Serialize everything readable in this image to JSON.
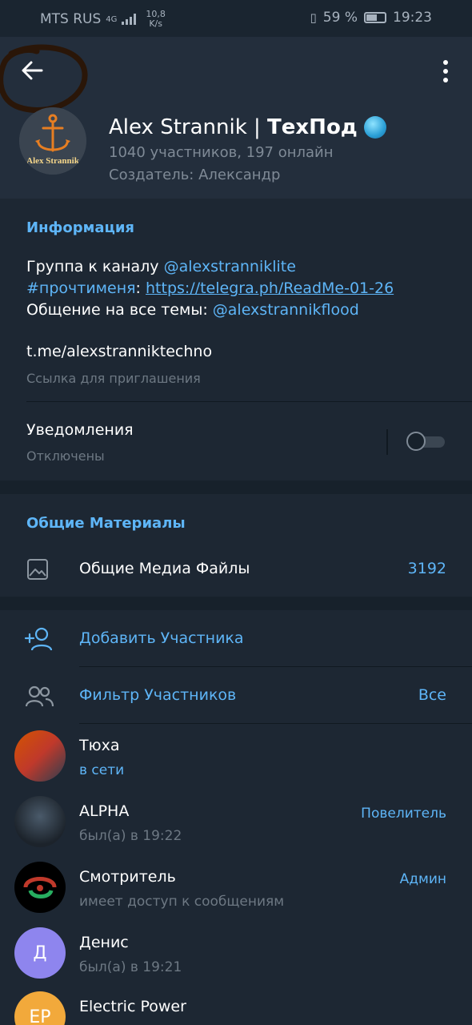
{
  "status_bar": {
    "carrier": "MTS RUS",
    "network": "4G",
    "speed_value": "10,8",
    "speed_unit": "K/s",
    "battery": "59 %",
    "time": "19:23"
  },
  "header": {
    "name": "Alex Strannik | ",
    "name_bold": "ТехПод",
    "members_online": "1040 участников, 197 онлайн",
    "creator": "Создатель: Александр",
    "logo_text": "Alex Strannik",
    "icons": [
      "arrow-left-icon",
      "more-vertical-icon",
      "globe-emoji-icon"
    ]
  },
  "info": {
    "section_title": "Информация",
    "line1_text": "Группа к каналу ",
    "line1_link": "@alexstranniklite",
    "line2_tag": "#прочтименя",
    "line2_sep": ": ",
    "line2_link": "https://telegra.ph/ReadMe-01-26",
    "line3_text": "Общение на все темы: ",
    "line3_link": "@alexstrannikflood",
    "invite_link": "t.me/alexstranniktechno",
    "invite_caption": "Ссылка для приглашения",
    "notifications_label": "Уведомления",
    "notifications_state": "Отключены",
    "notifications_enabled": false
  },
  "shared": {
    "section_title": "Общие Материалы",
    "media_label": "Общие Медиа Файлы",
    "media_count": "3192"
  },
  "members": {
    "add_label": "Добавить Участника",
    "filter_label": "Фильтр Участников",
    "filter_value": "Все",
    "list": [
      {
        "name": "Тюха",
        "status": "в сети",
        "role": "",
        "initials": "",
        "color": "#c0392b"
      },
      {
        "name": "ALPHA",
        "status": "был(а) в 19:22",
        "role": "Повелитель",
        "initials": "",
        "color": "#2c3e50"
      },
      {
        "name": "Смотритель",
        "status": "имеет доступ к сообщениям",
        "role": "Админ",
        "initials": "",
        "color": "#000000"
      },
      {
        "name": "Денис",
        "status": "был(а) в 19:21",
        "role": "",
        "initials": "Д",
        "color": "#8e85ee"
      },
      {
        "name": "Electric Power",
        "status": "",
        "role": "",
        "initials": "EP",
        "color": "#f2a93b"
      }
    ]
  },
  "colors": {
    "background": "#17212b",
    "header": "#232e3c",
    "section": "#1d2733",
    "accent": "#5eb5f7"
  }
}
